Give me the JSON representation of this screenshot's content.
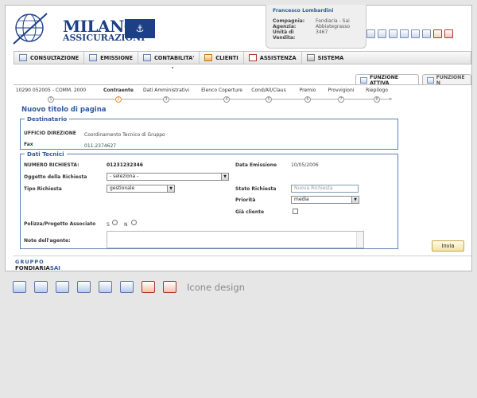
{
  "brand": {
    "line1": "MILANO",
    "line2": "ASSICURAZIONI"
  },
  "user": {
    "name": "Francesco Lombardini",
    "fields": [
      {
        "label": "Compagnia:",
        "value": "Fondiaria - Sai"
      },
      {
        "label": "Agenzia:",
        "value": "Abbiategrasso"
      },
      {
        "label": "Unità di Vendita:",
        "value": "3467"
      }
    ]
  },
  "top_icons": [
    "list-icon",
    "edit-icon",
    "form-icon",
    "card-icon",
    "settings-icon",
    "note-icon",
    "home-icon",
    "close-icon"
  ],
  "menu": [
    {
      "label": "CONSULTAZIONE",
      "icon": "consultazione-icon"
    },
    {
      "label": "EMISSIONE",
      "icon": "emissione-icon"
    },
    {
      "label": "CONTABILITA'",
      "icon": "contabilita-icon"
    },
    {
      "label": "CLIENTI",
      "icon": "clienti-icon"
    },
    {
      "label": "ASSISTENZA",
      "icon": "assistenza-icon"
    },
    {
      "label": "SISTEMA",
      "icon": "sistema-icon"
    }
  ],
  "funz_tabs": [
    {
      "label": "FUNZIONE ATTIVA"
    },
    {
      "label": "FUNZIONE N"
    }
  ],
  "steps": [
    {
      "label": "10290 052005 - COMM. 2000",
      "num": "1"
    },
    {
      "label": "Contraente",
      "num": "2"
    },
    {
      "label": "Dati Amministrativi",
      "num": "3"
    },
    {
      "label": "Elenco Coperture",
      "num": "4"
    },
    {
      "label": "Cond/All/Claus",
      "num": "5"
    },
    {
      "label": "Premio",
      "num": "6"
    },
    {
      "label": "Provvigioni",
      "num": "7"
    },
    {
      "label": "Riepilogo",
      "num": "8"
    }
  ],
  "current_step": 1,
  "page_title": "Nuovo titolo di pagina",
  "destinatario": {
    "legend": "Destinatario",
    "ufficio_label": "UFFICIO DIREZIONE",
    "ufficio_value": "Coordinamento Tecnico di Gruppo",
    "fax_label": "Fax",
    "fax_value": "011.2374627"
  },
  "dati_tecnici": {
    "legend": "Dati Tecnici",
    "numero_label": "NUMERO RICHIESTA:",
    "numero_value": "01231232346",
    "data_label": "Data Emissione",
    "data_value": "10/05/2006",
    "oggetto_label": "Oggetto della Richiesta",
    "oggetto_value": "- seleziona -",
    "tipo_label": "Tipo Richiesta",
    "tipo_value": "gestionale",
    "stato_label": "Stato Richiesta",
    "stato_placeholder": "Nuova Richiesta",
    "priorita_label": "Priorità",
    "priorita_value": "media",
    "gia_cliente_label": "Già cliente",
    "polizza_label": "Polizza/Progetto Associato",
    "radio_s": "S",
    "radio_n": "N",
    "note_label": "Note dell'agente:"
  },
  "invia_label": "Invia",
  "footer": {
    "gruppo": "GRUPPO",
    "fondiaria": "FONDIARIA",
    "sai": "SAI"
  },
  "design": {
    "icons": [
      "list-icon",
      "edit-icon",
      "form-icon",
      "card-icon",
      "settings-icon",
      "note-icon",
      "home-icon",
      "close-icon"
    ],
    "label": "Icone design"
  },
  "colors": {
    "accent": "#2d5aa0",
    "brand": "#1d3f86",
    "step_current": "#d9832f",
    "button": "#f2e2a8"
  }
}
